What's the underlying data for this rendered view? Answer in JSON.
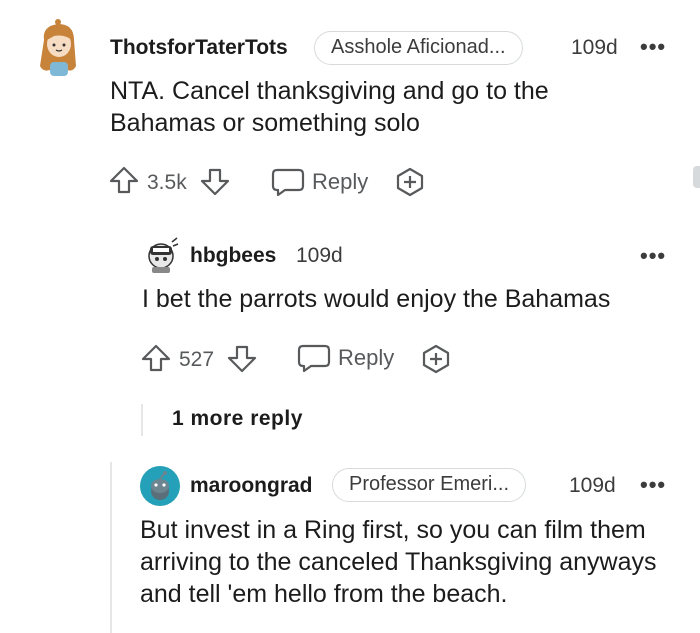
{
  "comments": [
    {
      "username": "ThotsforTaterTots",
      "flair": "Asshole Aficionad...",
      "time": "109d",
      "more": "•••",
      "body": "NTA. Cancel thanksgiving and go to the Bahamas or something solo",
      "votes": "3.5k",
      "reply_label": "Reply"
    },
    {
      "username": "hbgbees",
      "time": "109d",
      "more": "•••",
      "body": "I bet the parrots would enjoy the Bahamas",
      "votes": "527",
      "reply_label": "Reply"
    },
    {
      "username": "maroongrad",
      "flair": "Professor Emeri...",
      "time": "109d",
      "more": "•••",
      "body": "But invest in a Ring first, so you can film them arriving to the canceled Thanksgiving anyways and tell 'em hello from the beach."
    }
  ],
  "more_replies": "1 more reply",
  "colors": {
    "text": "#1c1c1c",
    "meta": "#3c3c3c",
    "action": "#57595b",
    "thread_line": "#e4e6e8",
    "maroongrad_avatar": "#24a0b8"
  },
  "icons": [
    "upvote-icon",
    "downvote-icon",
    "comment-icon",
    "award-icon",
    "more-options-icon"
  ]
}
